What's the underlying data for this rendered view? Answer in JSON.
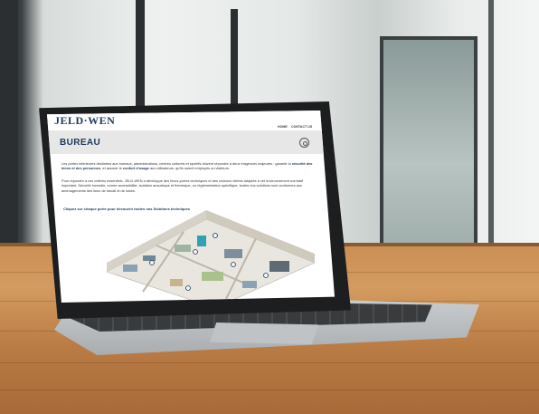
{
  "brand": {
    "logo": "JELD·WEN"
  },
  "nav": {
    "items": [
      "HOME",
      "CONTACT US"
    ]
  },
  "hero": {
    "title": "BUREAU"
  },
  "content": {
    "paragraph1_a": "Les portes intérieures destinées aux bureaux, administrations, centres culturels et sportifs doivent répondre à deux exigences majeures : garantir la ",
    "paragraph1_b": "sécurité des biens et des personnes",
    "paragraph1_c": ", et assurer le ",
    "paragraph1_d": "confort d'usage",
    "paragraph1_e": " aux utilisateurs, qu'ils soient employés ou visiteurs.",
    "paragraph2": "Pour répondre à ces critères essentiels, JELD-WEN a développé des blocs-portes techniques et des cloisons vitrées adaptés à cet environnement normatif important. Sécurité incendie, norme accessibilité, isolation acoustique et thermique, ou réglementation spécifique, toutes nos solutions sont conformes aux aménagements des lieux de travail et de loisirs.",
    "link": "Cliquez sur chaque porte pour découvrir toutes nos Solutions techniques"
  },
  "colors": {
    "brand_navy": "#1d3a5c",
    "hero_bg": "#e7e7e7",
    "accent_teal": "#2ea3b0"
  }
}
